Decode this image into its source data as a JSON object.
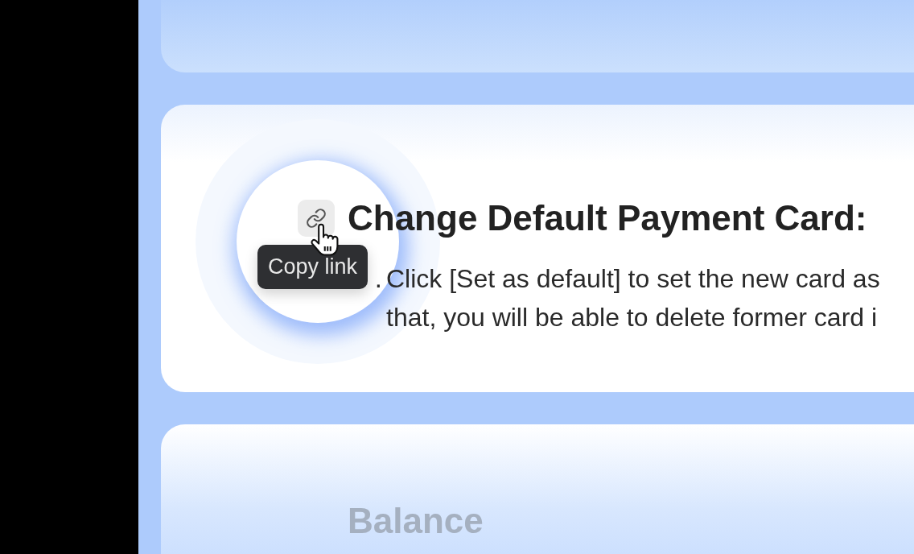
{
  "section": {
    "link_button": {
      "hovered": true,
      "tooltip": "Copy link"
    },
    "heading": "Change Default Payment Card:",
    "steps": [
      {
        "marker": ".",
        "lines": [
          "Click [Set as default] to set the new card as",
          "that, you will be able to delete former card i"
        ]
      }
    ]
  },
  "next_section": {
    "heading": "Balance"
  }
}
